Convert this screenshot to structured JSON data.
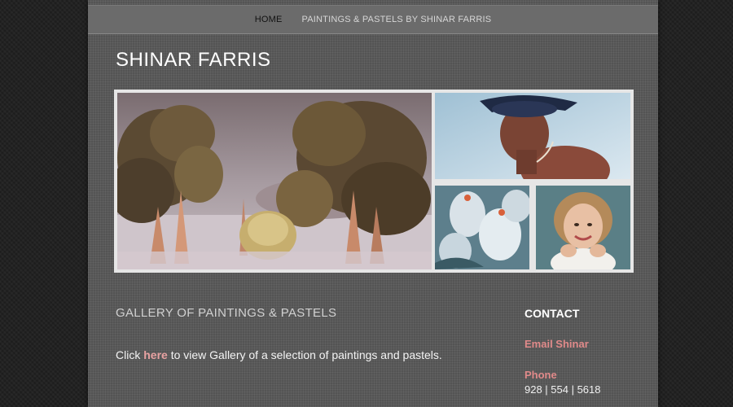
{
  "nav": {
    "home": "HOME",
    "paintings": "PAINTINGS & PASTELS BY SHINAR FARRIS"
  },
  "site": {
    "title": "SHINAR FARRIS"
  },
  "gallery": {
    "images": [
      {
        "name": "landscape-painting-image"
      },
      {
        "name": "boy-portrait-image"
      },
      {
        "name": "tulips-painting-image"
      },
      {
        "name": "girl-portrait-image"
      }
    ]
  },
  "main": {
    "heading": "GALLERY OF PAINTINGS & PASTELS",
    "intro_prefix": "Click ",
    "intro_link": "here",
    "intro_suffix": " to view Gallery of a selection of paintings and pastels."
  },
  "contact": {
    "heading": "CONTACT",
    "email_label": "Email Shinar",
    "phone_label": "Phone",
    "phone_number": "928 | 554 | 5618"
  },
  "colors": {
    "page_bg": "#5a5a5a",
    "outer_bg": "#1f1f1f",
    "accent_link": "#e08a8a",
    "title": "#ffffff"
  }
}
